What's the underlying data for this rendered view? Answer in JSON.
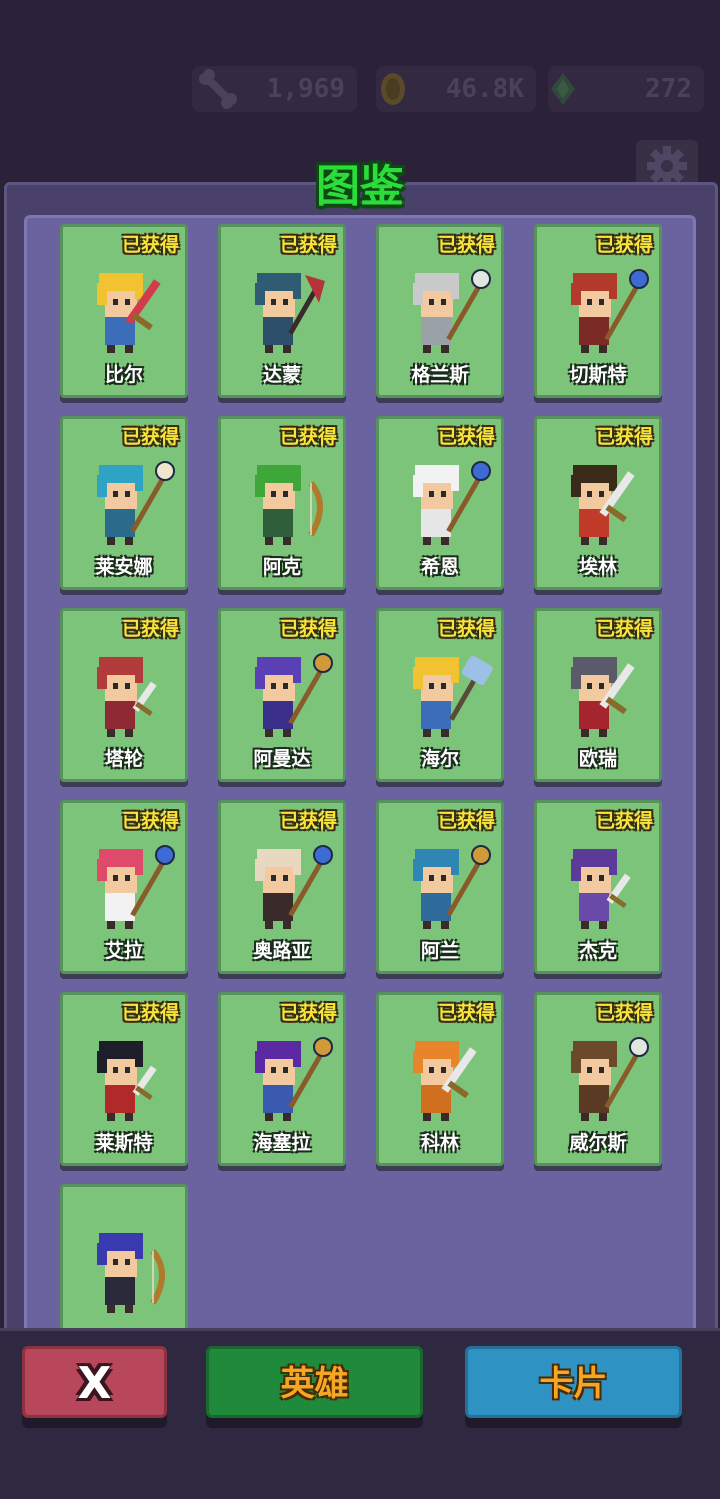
{
  "resources": {
    "bone": {
      "icon": "bone-icon",
      "value": "1,969"
    },
    "coin": {
      "icon": "coin-icon",
      "value": "46.8K"
    },
    "gem": {
      "icon": "gem-icon",
      "value": "272"
    }
  },
  "header": {
    "title": "图鉴",
    "settings_icon": "gear-icon"
  },
  "colors": {
    "card_bg": "#7cc47a",
    "panel_bg": "#4a416a",
    "inner_bg": "#6a63a0",
    "title_green": "#2bdc3a",
    "badge_yellow": "#f6e63c"
  },
  "cards": [
    {
      "name": "比尔",
      "badge": "已获得",
      "hair": "#f2c230",
      "outfit": "#3c6db8",
      "weapon": "sword",
      "weapon_color": "#d23b4b"
    },
    {
      "name": "达蒙",
      "badge": "已获得",
      "hair": "#2f5b73",
      "outfit": "#2d4f6a",
      "weapon": "axe",
      "weapon_color": "#b7333a"
    },
    {
      "name": "格兰斯",
      "badge": "已获得",
      "hair": "#c9c9c9",
      "outfit": "#9aa2a8",
      "weapon": "staff",
      "weapon_color": "#e0e7df"
    },
    {
      "name": "切斯特",
      "badge": "已获得",
      "hair": "#b23a2a",
      "outfit": "#7b2a25",
      "weapon": "staff",
      "weapon_color": "#3e6ad3"
    },
    {
      "name": "莱安娜",
      "badge": "已获得",
      "hair": "#2ea3c4",
      "outfit": "#2a6b8c",
      "weapon": "staff",
      "weapon_color": "#efe6d0"
    },
    {
      "name": "阿克",
      "badge": "已获得",
      "hair": "#3fa63a",
      "outfit": "#2e5f3a",
      "weapon": "bow",
      "weapon_color": "#b07a2b"
    },
    {
      "name": "希恩",
      "badge": "已获得",
      "hair": "#f2f2f2",
      "outfit": "#e6e6e6",
      "weapon": "staff",
      "weapon_color": "#3e6ad3"
    },
    {
      "name": "埃林",
      "badge": "已获得",
      "hair": "#3a2a1a",
      "outfit": "#c23a2a",
      "weapon": "sword",
      "weapon_color": "#e8e8e8"
    },
    {
      "name": "塔轮",
      "badge": "已获得",
      "hair": "#b33a3a",
      "outfit": "#8f2a34",
      "weapon": "dagger",
      "weapon_color": "#e8e8e8"
    },
    {
      "name": "阿曼达",
      "badge": "已获得",
      "hair": "#5a3fb5",
      "outfit": "#3a2f8a",
      "weapon": "staff",
      "weapon_color": "#d09a3b"
    },
    {
      "name": "海尔",
      "badge": "已获得",
      "hair": "#f2c230",
      "outfit": "#3c6db8",
      "weapon": "hammer",
      "weapon_color": "#9cc0e6"
    },
    {
      "name": "欧瑞",
      "badge": "已获得",
      "hair": "#5a5a6a",
      "outfit": "#a6242e",
      "weapon": "sword",
      "weapon_color": "#e8e8e8"
    },
    {
      "name": "艾拉",
      "badge": "已获得",
      "hair": "#e04a6a",
      "outfit": "#f2f2f2",
      "weapon": "staff",
      "weapon_color": "#3e6ad3"
    },
    {
      "name": "奥路亚",
      "badge": "已获得",
      "hair": "#e8d8c0",
      "outfit": "#3a2a2a",
      "weapon": "staff",
      "weapon_color": "#3e6ad3"
    },
    {
      "name": "阿兰",
      "badge": "已获得",
      "hair": "#2e86b5",
      "outfit": "#2e6a9a",
      "weapon": "staff",
      "weapon_color": "#d09a3b"
    },
    {
      "name": "杰克",
      "badge": "已获得",
      "hair": "#5b3a9a",
      "outfit": "#6a4aa8",
      "weapon": "dagger",
      "weapon_color": "#e8e8e8"
    },
    {
      "name": "莱斯特",
      "badge": "已获得",
      "hair": "#1e1e2a",
      "outfit": "#b02a2a",
      "weapon": "dagger",
      "weapon_color": "#e8e8e8"
    },
    {
      "name": "海塞拉",
      "badge": "已获得",
      "hair": "#5b2aa3",
      "outfit": "#3a5ab0",
      "weapon": "staff",
      "weapon_color": "#d09a3b"
    },
    {
      "name": "科林",
      "badge": "已获得",
      "hair": "#e8842a",
      "outfit": "#d0701e",
      "weapon": "sword",
      "weapon_color": "#e8e8e8"
    },
    {
      "name": "威尔斯",
      "badge": "已获得",
      "hair": "#6a4a2a",
      "outfit": "#5a3a22",
      "weapon": "staff",
      "weapon_color": "#e0e7df"
    },
    {
      "name": "",
      "badge": "",
      "hair": "#3a3ab0",
      "outfit": "#2a2a3a",
      "weapon": "bow",
      "weapon_color": "#b07a2b"
    }
  ],
  "buttons": {
    "close": {
      "label": "X",
      "icon": "close-icon"
    },
    "heroes": {
      "label": "英雄"
    },
    "cards": {
      "label": "卡片"
    }
  }
}
